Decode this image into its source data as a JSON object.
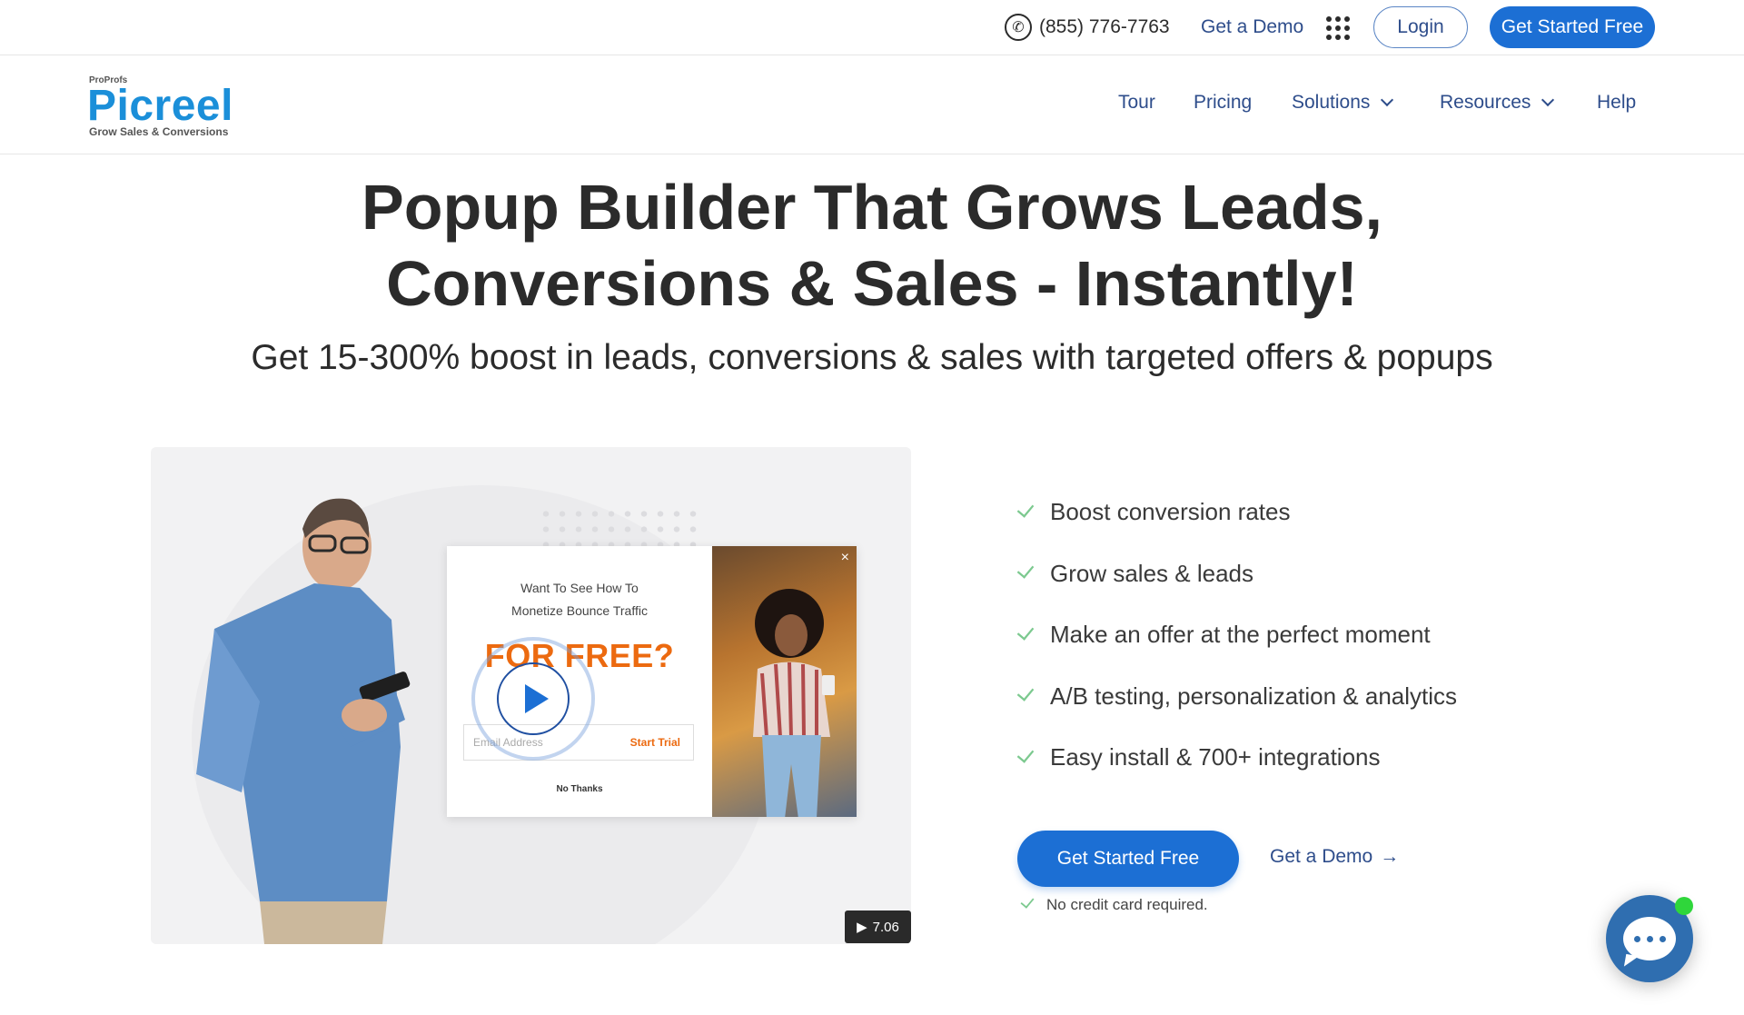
{
  "topbar": {
    "phone": "(855) 776-7763",
    "demo_label": "Get a Demo",
    "apps_icon": "grid-dots-icon",
    "login_label": "Login",
    "cta_label": "Get Started Free"
  },
  "brand": {
    "parent": "ProProfs",
    "name": "Picreel",
    "tagline": "Grow Sales & Conversions",
    "color": "#1b8fd9"
  },
  "nav": {
    "items": [
      {
        "label": "Tour",
        "dropdown": false
      },
      {
        "label": "Pricing",
        "dropdown": false
      },
      {
        "label": "Solutions",
        "dropdown": true
      },
      {
        "label": "Resources",
        "dropdown": true
      },
      {
        "label": "Help",
        "dropdown": false
      }
    ]
  },
  "hero": {
    "headline_line1": "Popup Builder That Grows Leads,",
    "headline_line2": "Conversions & Sales - Instantly!",
    "subhead": "Get 15-300% boost in leads, conversions & sales with targeted offers & popups"
  },
  "video": {
    "popup_question_line1": "Want To See How To",
    "popup_question_line2": "Monetize Bounce Traffic",
    "popup_offer": "FOR FREE?",
    "popup_email_placeholder": "Email Address",
    "popup_trial_label": "Start Trial",
    "popup_dismiss": "No Thanks",
    "popup_close": "×",
    "duration_icon": "▶",
    "duration": "7.06"
  },
  "features": [
    "Boost conversion rates",
    "Grow sales & leads",
    "Make an offer at the perfect moment",
    "A/B testing, personalization & analytics",
    "Easy install & 700+ integrations"
  ],
  "cta": {
    "primary_label": "Get Started Free",
    "secondary_label": "Get a Demo",
    "secondary_arrow": "→",
    "note": "No credit card required."
  },
  "colors": {
    "primary": "#1c6fd4",
    "link": "#2e4d8b",
    "check": "#7cc98f",
    "offer": "#ec6a10",
    "chat": "#2f6eb0",
    "online": "#2fd63b"
  }
}
